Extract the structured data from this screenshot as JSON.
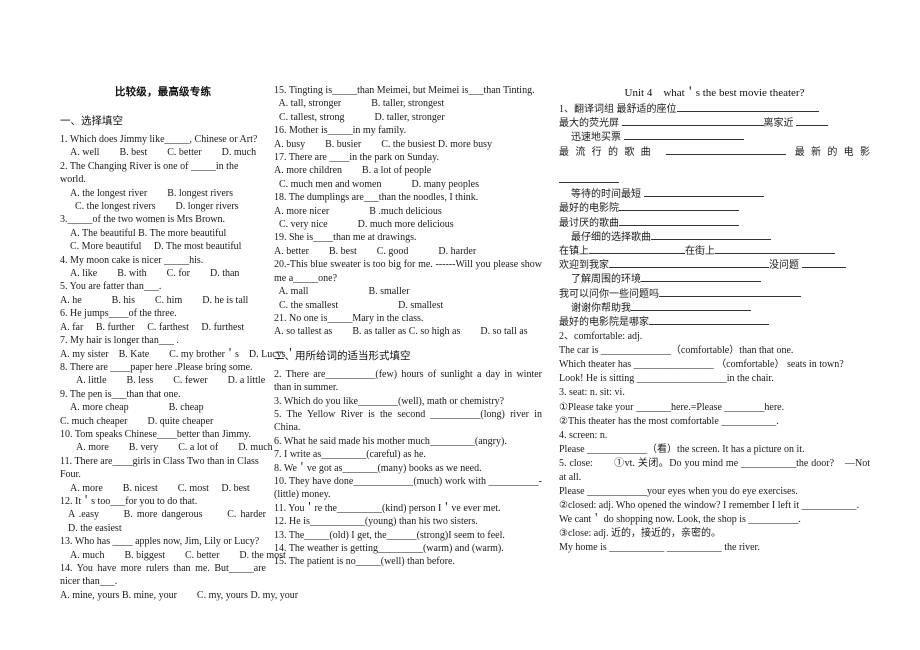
{
  "document": {
    "title": "比较级，最高级专练",
    "section_one_head": "一、选择填空",
    "section_two_head": "二、用所给词的适当形式填空",
    "unit_title": "Unit 4　what＇s the best movie theater?"
  },
  "col1": {
    "items": [
      {
        "q": "1. Which does Jimmy like_____, Chinese or Art?",
        "opts": [
          "A. well　　B. best　　C. better　　D. much"
        ]
      },
      {
        "q": "2. The Changing River is one of  _____in the world.",
        "opts": [
          "A. the longest river　　B. longest rivers",
          "  C. the longest rivers　　D. longer rivers"
        ]
      },
      {
        "q": "3._____of the two women is Mrs Brown.",
        "opts": [
          "A. The beautiful B. The more beautiful",
          "C. More beautiful　 D. The most beautiful"
        ]
      },
      {
        "q": "4. My moon cake is nicer  _____his.",
        "opts": [
          "A. like　　B. with　　C. for　　D. than"
        ]
      },
      {
        "q": "5. You are fatter than___.",
        "opts": [
          "A. he　　　B. his　　C. him　　D. he is tall"
        ]
      },
      {
        "q": "6. He jumps____of the three.",
        "opts": [
          "A. far　 B. further　 C. farthest　 D. furthest"
        ]
      },
      {
        "q": "7. My hair is longer than___ .",
        "opts": [
          "A. my sister　B. Kate　　C. my brother＇s　D. Lucys＇"
        ]
      },
      {
        "q": "8. There are  ____paper here .Please bring some.",
        "opts": [
          "A. little　　B. less　　C. fewer　　D. a little"
        ]
      },
      {
        "q": "9. The pen is___than that one.",
        "opts": [
          "A. more cheap　　　　B. cheap",
          "C. much cheaper　　D. quite cheaper"
        ]
      },
      {
        "q": "10. Tom speaks Chinese____better than Jimmy.",
        "opts": [
          "A. more　　B. very　　C. a lot of　　D. much"
        ]
      },
      {
        "q": "11. There are____girls in Class Two than in Class Four.",
        "opts": [
          "A. more　　B. nicest　　C. most　 D. best"
        ]
      },
      {
        "q": "12. It＇s too___for you to do that.",
        "opts": [
          "A .easy　　B. more dangerous　　C. harder　　D. the easiest"
        ]
      },
      {
        "q": "13. Who has  ____ apples now, Jim, Lily or Lucy?",
        "opts": [
          "A. much　　B. biggest　　C. better　　D. the most"
        ]
      },
      {
        "q": "14. You have more rulers than me. But_____are nicer than___.",
        "opts": [
          "A. mine, yours B. mine, your　　C. my, yours D. my, your"
        ]
      }
    ]
  },
  "col2": {
    "items": [
      {
        "q": "15. Tingting is_____than Meimei, but Meimei is___than Tinting.",
        "opts": [
          "  A. tall, stronger　　　B. taller, strongest",
          "  C. tallest, strong　　　D. taller, stronger"
        ]
      },
      {
        "q": "16. Mother is_____in my family.",
        "opts": [
          "A. busy　　B. busier　　C. the busiest D. more busy"
        ]
      },
      {
        "q": "17. There are  ____in the park on Sunday.",
        "opts": [
          "A. more children　　B. a lot of people",
          "  C. much men and women　　　D. many peoples"
        ]
      },
      {
        "q": "18. The dumplings are___than the noodles, I think.",
        "opts": [
          "A. more nicer　　　　B .much delicious",
          "  C. very nice　　　D. much more delicious"
        ]
      },
      {
        "q": "19. She is____than me at drawings.",
        "opts": [
          "A. better　　B. best　　C. good　　　D. harder"
        ]
      },
      {
        "q": "20.-This blue sweater is too big for me. ------Will you please show me a_____one?",
        "opts": [
          "  A. mall　　　　　　B. smaller",
          "  C. the smallest　　　　　　D. smallest"
        ]
      },
      {
        "q": "21. No one is_____Mary in the class.",
        "opts": [
          "A. so tallest as　　B. as taller as C. so high as　　D. so tall as"
        ]
      }
    ],
    "fill_items": [
      " 2. There are__________(few) hours of sunlight a day in winter than in summer.",
      "3. Which do you like________(well), math or chemistry?",
      "5. The Yellow River is the second __________(long) river  in China.",
      "6. What he said made his mother much_________(angry).",
      "7. I write as_________(careful) as he.",
      "8. We＇ve got as_______(many) books as we need.",
      "10. They have done____________(much) work with __________-(little) money.",
      "11. You＇re the_________(kind) person I＇ve ever met.",
      "12. He is___________(young) than his two sisters.",
      "13. The_____(old) I get, the______(strong)I seem to feel.",
      "14. The weather is getting_________(warm) and (warm).",
      "15. The patient is no_____(well) than before."
    ]
  },
  "col3": {
    "translate_head": "1、翻译词组",
    "translate_items": [
      "最舒适的座位",
      "最大的荧光屏",
      "离家近",
      "迅速地买票",
      "最流行的歌曲",
      "最新的电影",
      "等待的时间最短",
      "最好的电影院",
      "最讨厌的歌曲",
      "最仔细的选择歌曲",
      "在镇上",
      "在街上",
      "欢迎到我家",
      "没问题",
      "了解周围的环境",
      "我可以问你一些问题吗",
      "谢谢你帮助我",
      "最好的电影院是哪家"
    ],
    "entries": [
      {
        "head": "2、comfortable: adj.",
        "lines": [
          "The car is ______________（comfortable）than that one.",
          "Which theater has  ________________ （comfortable） seats in town?",
          "Look! He is sitting __________________in the chair."
        ]
      },
      {
        "head": "3. seat: n. sit: vi.",
        "lines": [
          "①Please take your _______here.=Please ________here.",
          "②This theater has the most comfortable ___________."
        ]
      },
      {
        "head": "4. screen: n.",
        "lines": [
          "Please ____________（看）the screen. It has a picture on it."
        ]
      },
      {
        "head": "5. close:　　①vt. 关闭。Do you mind me ___________the door?　—Not at all.",
        "lines": [
          "Please ____________your eyes when you do eye exercises.",
          "②closed: adj. Who opened the window? I remember I left it ___________.",
          "We cant＇ do shopping now. Look, the shop is __________.",
          "③close: adj. 近的，接近的，亲密的。",
          "My home is ___________ ___________ the river."
        ]
      }
    ]
  }
}
